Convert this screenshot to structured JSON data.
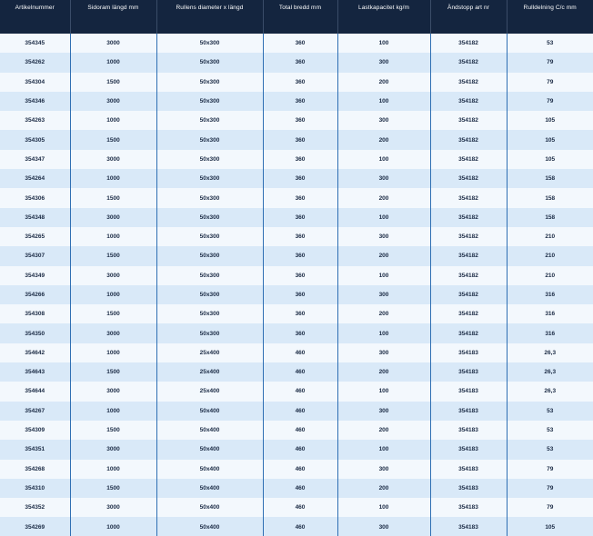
{
  "table": {
    "headers": [
      "Artikelnummer",
      "Sidoram längd mm",
      "Rullens diameter x längd",
      "Total bredd mm",
      "Lastkapacitet kg/m",
      "Ändstopp art nr",
      "Rulldelning C/c mm"
    ],
    "rows": [
      [
        "354345",
        "3000",
        "50x300",
        "360",
        "100",
        "354182",
        "53"
      ],
      [
        "354262",
        "1000",
        "50x300",
        "360",
        "300",
        "354182",
        "79"
      ],
      [
        "354304",
        "1500",
        "50x300",
        "360",
        "200",
        "354182",
        "79"
      ],
      [
        "354346",
        "3000",
        "50x300",
        "360",
        "100",
        "354182",
        "79"
      ],
      [
        "354263",
        "1000",
        "50x300",
        "360",
        "300",
        "354182",
        "105"
      ],
      [
        "354305",
        "1500",
        "50x300",
        "360",
        "200",
        "354182",
        "105"
      ],
      [
        "354347",
        "3000",
        "50x300",
        "360",
        "100",
        "354182",
        "105"
      ],
      [
        "354264",
        "1000",
        "50x300",
        "360",
        "300",
        "354182",
        "158"
      ],
      [
        "354306",
        "1500",
        "50x300",
        "360",
        "200",
        "354182",
        "158"
      ],
      [
        "354348",
        "3000",
        "50x300",
        "360",
        "100",
        "354182",
        "158"
      ],
      [
        "354265",
        "1000",
        "50x300",
        "360",
        "300",
        "354182",
        "210"
      ],
      [
        "354307",
        "1500",
        "50x300",
        "360",
        "200",
        "354182",
        "210"
      ],
      [
        "354349",
        "3000",
        "50x300",
        "360",
        "100",
        "354182",
        "210"
      ],
      [
        "354266",
        "1000",
        "50x300",
        "360",
        "300",
        "354182",
        "316"
      ],
      [
        "354308",
        "1500",
        "50x300",
        "360",
        "200",
        "354182",
        "316"
      ],
      [
        "354350",
        "3000",
        "50x300",
        "360",
        "100",
        "354182",
        "316"
      ],
      [
        "354642",
        "1000",
        "25x400",
        "460",
        "300",
        "354183",
        "26,3"
      ],
      [
        "354643",
        "1500",
        "25x400",
        "460",
        "200",
        "354183",
        "26,3"
      ],
      [
        "354644",
        "3000",
        "25x400",
        "460",
        "100",
        "354183",
        "26,3"
      ],
      [
        "354267",
        "1000",
        "50x400",
        "460",
        "300",
        "354183",
        "53"
      ],
      [
        "354309",
        "1500",
        "50x400",
        "460",
        "200",
        "354183",
        "53"
      ],
      [
        "354351",
        "3000",
        "50x400",
        "460",
        "100",
        "354183",
        "53"
      ],
      [
        "354268",
        "1000",
        "50x400",
        "460",
        "300",
        "354183",
        "79"
      ],
      [
        "354310",
        "1500",
        "50x400",
        "460",
        "200",
        "354183",
        "79"
      ],
      [
        "354352",
        "3000",
        "50x400",
        "460",
        "100",
        "354183",
        "79"
      ],
      [
        "354269",
        "1000",
        "50x400",
        "460",
        "300",
        "354183",
        "105"
      ]
    ]
  },
  "colors": {
    "header_bg": "#14253f",
    "row_light": "#f3f8fd",
    "row_dark": "#d9e9f8",
    "divider": "#2f6fb3"
  }
}
